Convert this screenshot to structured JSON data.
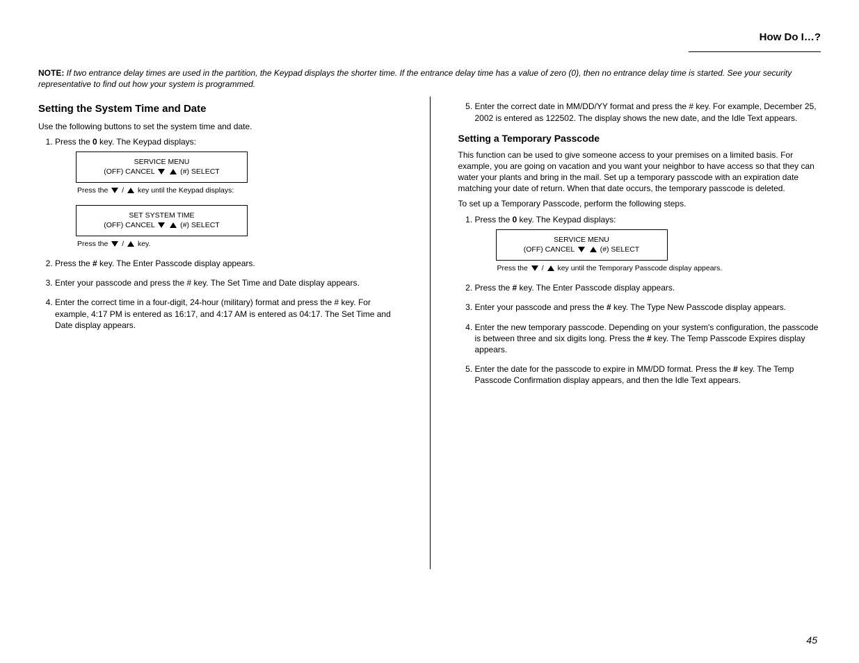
{
  "header": {
    "title": "How Do I…?"
  },
  "topnote": {
    "prefix_bold": "NOTE: ",
    "body_italic": "If two entrance delay times are used in the partition, the Keypad displays the shorter time. If the entrance delay time has a value of zero (0), then no entrance delay time is started.",
    "body_plain": " See your security representative to find out how your system is programmed."
  },
  "left": {
    "section_title": "Setting the System Time and Date",
    "intro": "Use the following buttons to set the system time and date.",
    "step1_a": "Press the ",
    "step1_bold": "0",
    "step1_b": " key. The Keypad displays:",
    "box1_line1": "SERVICE MENU",
    "box1_line2_a": "(OFF) CANCEL ",
    "box1_line2_b": " (#) SELECT",
    "under1_a": "Press the ",
    "under1_b": " key until the Keypad displays:",
    "box2_line1": "SET SYSTEM TIME",
    "box2_line2_a": "(OFF) CANCEL ",
    "box2_line2_b": " (#) SELECT",
    "under2_a": "Press the ",
    "under2_b": " key.",
    "step2_a": "Press the ",
    "step2_bold": "#",
    "step2_b": " key. The Enter Passcode display appears.",
    "step3": "Enter your passcode and press the # key. The Set Time and Date display appears.",
    "step4": "Enter the correct time in a four-digit, 24-hour (military) format and press the # key. For example, 4:17 PM is entered as 16:17, and 4:17 AM is entered as 04:17. The Set Time and Date display appears."
  },
  "right": {
    "step5": "Enter the correct date in MM/DD/YY format and press the # key. For example, December 25, 2002 is entered as 122502. The display shows the new date, and the Idle Text appears.",
    "section_title": "Setting a Temporary Passcode",
    "p1": "This function can be used to give someone access to your premises on a limited basis. For example, you are going on vacation and you want your neighbor to have access so that they can water your plants and bring in the mail. Set up a temporary passcode with an expiration date matching your date of return. When that date occurs, the temporary passcode is deleted.",
    "p2": "To set up a Temporary Passcode, perform the following steps.",
    "step1_a": "Press the ",
    "step1_bold": "0",
    "step1_b": " key. The Keypad displays:",
    "box_line1": "SERVICE MENU",
    "box_line2_a": "(OFF) CANCEL ",
    "box_line2_b": " (#) SELECT",
    "under_a": "Press the ",
    "under_b": " key until the Temporary Passcode display appears.",
    "step2_a": "Press the ",
    "step2_bold": "#",
    "step2_b": " key. The Enter Passcode display appears.",
    "step3_a": "Enter your passcode and press the ",
    "step3_bold": "#",
    "step3_b": " key. The Type New Passcode display appears.",
    "step4_a": "Enter the new temporary passcode. Depending on your system's configuration, the passcode is between three and six digits long. Press the ",
    "step4_bold": "#",
    "step4_b": " key. The Temp Passcode Expires display appears.",
    "step5_a": "Enter the date for the passcode to expire in MM/DD format. Press the ",
    "step5_bold": "#",
    "step5_b": " key. The Temp Passcode Confirmation display appears, and then the Idle Text appears."
  },
  "page_number": "45"
}
